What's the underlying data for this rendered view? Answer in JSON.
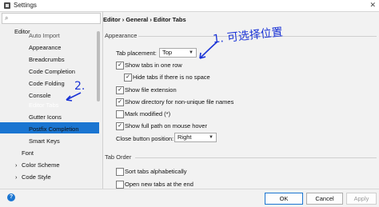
{
  "window": {
    "title": "Settings",
    "close_glyph": "✕"
  },
  "search": {
    "glyph": "⌕"
  },
  "sidebar": {
    "top_group": "Editor",
    "items": [
      {
        "label": "Auto Import"
      },
      {
        "label": "Appearance"
      },
      {
        "label": "Breadcrumbs"
      },
      {
        "label": "Code Completion"
      },
      {
        "label": "Code Folding"
      },
      {
        "label": "Console"
      },
      {
        "label": "Editor Tabs"
      },
      {
        "label": "Gutter Icons"
      },
      {
        "label": "Postfix Completion"
      },
      {
        "label": "Smart Keys"
      }
    ],
    "groups": [
      {
        "label": "Font"
      },
      {
        "label": "Color Scheme",
        "arrow": "›"
      },
      {
        "label": "Code Style",
        "arrow": "›"
      }
    ],
    "selected": "Editor Tabs"
  },
  "main": {
    "breadcrumb": "Editor › General › Editor Tabs",
    "appearance_title": "Appearance",
    "tab_placement_label": "Tab placement:",
    "tab_placement_value": "Top",
    "show_tabs_one_row": "Show tabs in one row",
    "hide_tabs_no_space": "Hide tabs if there is no space",
    "show_file_extension": "Show file extension",
    "show_directory": "Show directory for non-unique file names",
    "mark_modified": "Mark modified (*)",
    "show_full_path": "Show full path on mouse hover",
    "close_button_label": "Close button position:",
    "close_button_value": "Right",
    "tab_order_title": "Tab Order",
    "sort_tabs": "Sort tabs alphabetically",
    "open_new_tabs": "Open new tabs at the end",
    "check_glyph": "✓"
  },
  "footer": {
    "help": "?",
    "ok": "OK",
    "cancel": "Cancel",
    "apply": "Apply"
  },
  "annotation": {
    "handwritten": "1. 可选择位置",
    "marker": "2."
  },
  "colors": {
    "accent": "#1a75d1",
    "annotation": "#1a33d6"
  }
}
